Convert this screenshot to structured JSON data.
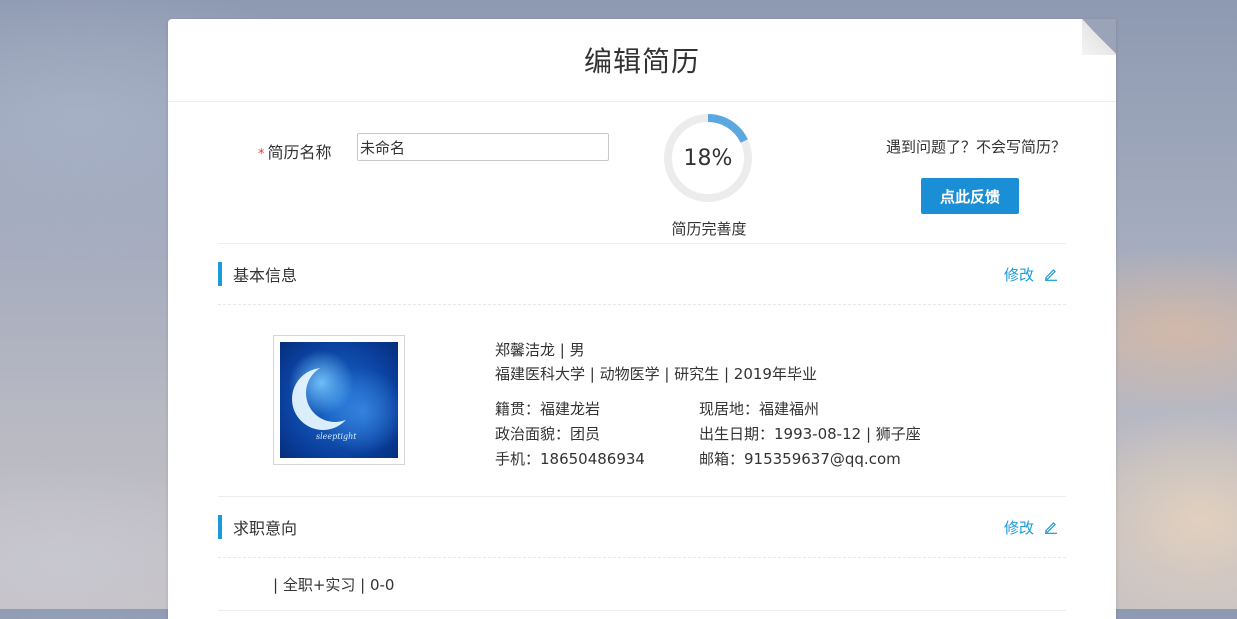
{
  "header": {
    "title": "编辑简历"
  },
  "resume_name": {
    "required_mark": "*",
    "label": "简历名称",
    "value": "未命名"
  },
  "completeness": {
    "percent_text": "18%",
    "percent": 18,
    "label": "简历完善度",
    "ring_color": "#5ba7e0",
    "track_color": "#ececec"
  },
  "help": {
    "text": "遇到问题了？不会写简历？",
    "button_label": "点此反馈",
    "button_color": "#1b8fd6"
  },
  "basic_info": {
    "title": "基本信息",
    "edit_label": "修改",
    "name_gender": "郑馨洁龙 | 男",
    "education": "福建医科大学 | 动物医学 | 研究生 | 2019年毕业",
    "native_place": "籍贯：福建龙岩",
    "residence": "现居地：福建福州",
    "political_status": "政治面貌：团员",
    "birth": "出生日期：1993-08-12 | 狮子座",
    "phone": "手机：18650486934",
    "email": "邮箱：915359637@qq.com",
    "photo_caption": "sleeptight"
  },
  "job_intent": {
    "title": "求职意向",
    "edit_label": "修改",
    "summary": "| 全职+实习 | 0-0"
  },
  "accent_color": "#1a9ad9"
}
